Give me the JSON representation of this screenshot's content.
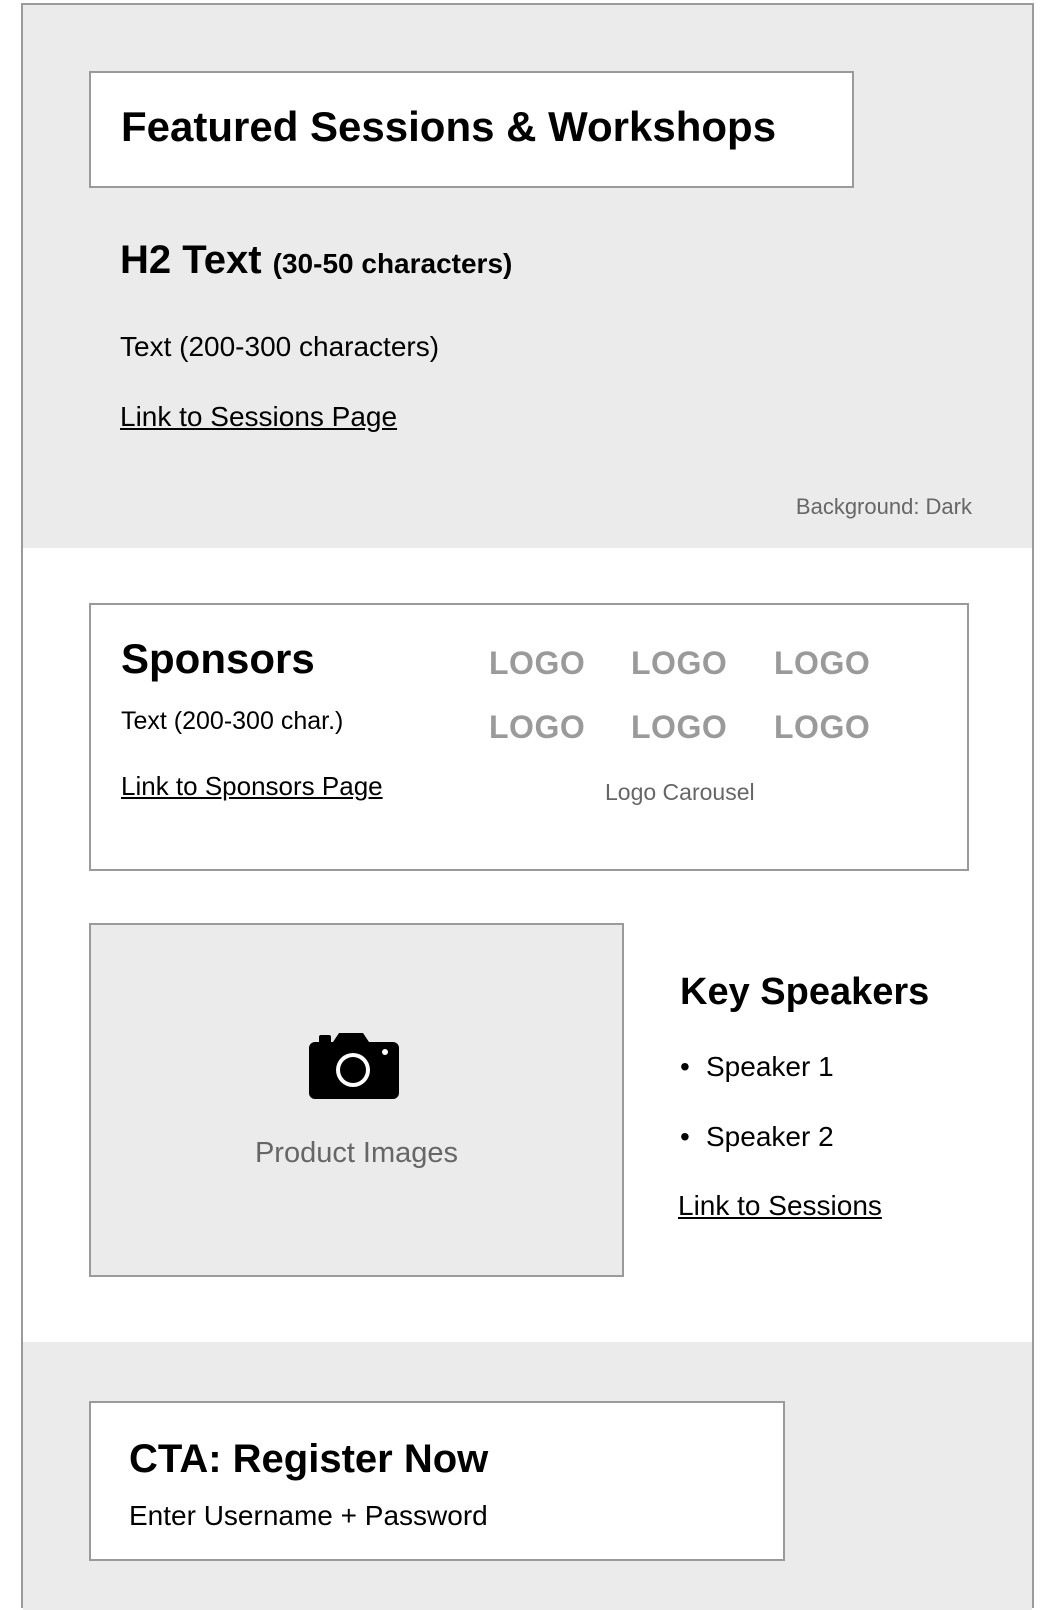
{
  "featured": {
    "title": "Featured Sessions & Workshops",
    "h2_main": "H2 Text",
    "h2_hint": "(30-50 characters)",
    "text": "Text (200-300 characters)",
    "link": "Link to Sessions Page",
    "background_note": "Background: Dark"
  },
  "sponsors": {
    "title": "Sponsors",
    "text": "Text (200-300 char.)",
    "link": "Link to Sponsors Page",
    "logos": [
      "LOGO",
      "LOGO",
      "LOGO",
      "LOGO",
      "LOGO",
      "LOGO"
    ],
    "carousel_label": "Logo Carousel"
  },
  "product": {
    "icon": "camera-icon",
    "label": "Product Images"
  },
  "speakers": {
    "title": "Key Speakers",
    "items": [
      "Speaker 1",
      "Speaker 2"
    ],
    "bullet": "•",
    "link": "Link to Sessions"
  },
  "cta": {
    "title": "CTA: Register Now",
    "subtitle": "Enter Username + Password"
  },
  "colors": {
    "dark_background": "#ebebeb",
    "border": "#9a9a9a",
    "muted_text": "#666666",
    "logo_gray": "#9a9a9a"
  }
}
